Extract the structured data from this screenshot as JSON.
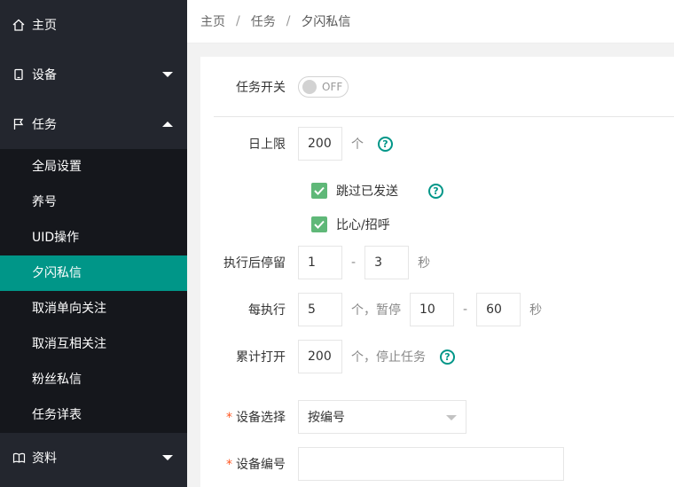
{
  "sidebar": {
    "home": "主页",
    "device": "设备",
    "task": "任务",
    "task_items": [
      "全局设置",
      "养号",
      "UID操作",
      "夕闪私信",
      "取消单向关注",
      "取消互相关注",
      "粉丝私信",
      "任务详表"
    ],
    "active_item": "夕闪私信",
    "data": "资料"
  },
  "breadcrumb": [
    "主页",
    "任务",
    "夕闪私信"
  ],
  "form": {
    "task_switch_label": "任务开关",
    "task_switch_state": "OFF",
    "daily_limit_label": "日上限",
    "daily_limit_value": "200",
    "daily_limit_unit": "个",
    "skip_sent_label": "跳过已发送",
    "bixin_label": "比心/招呼",
    "stay_label": "执行后停留",
    "stay_min": "1",
    "stay_max": "3",
    "stay_unit": "秒",
    "every_label": "每执行",
    "every_count": "5",
    "every_unit": "个，暂停",
    "pause_min": "10",
    "pause_max": "60",
    "pause_unit": "秒",
    "total_label": "累计打开",
    "total_value": "200",
    "total_unit": "个，停止任务",
    "device_select_label": "设备选择",
    "device_select_value": "按编号",
    "device_number_label": "设备编号",
    "device_number_value": "",
    "dash": "-",
    "required_mark": "*",
    "help_glyph": "?"
  },
  "colors": {
    "sidebar_bg": "#23262e",
    "submenu_bg": "#15171c",
    "active": "#009688",
    "checkbox": "#5fb878",
    "required": "#ff5722"
  }
}
